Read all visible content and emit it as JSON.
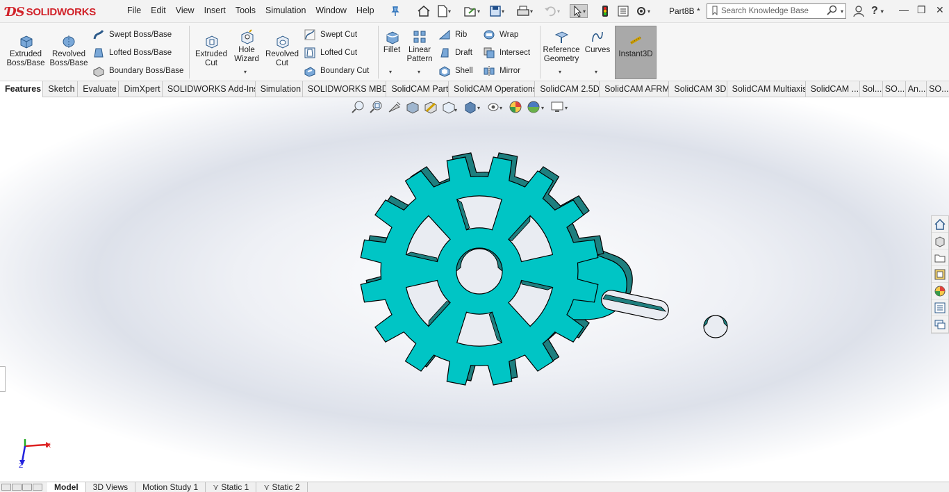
{
  "app": {
    "logo_ds": "ƊS",
    "logo_text": "SOLIDWORKS",
    "document_name": "Part8B *"
  },
  "menu": [
    "File",
    "Edit",
    "View",
    "Insert",
    "Tools",
    "Simulation",
    "Window",
    "Help"
  ],
  "search": {
    "placeholder": "Search Knowledge Base"
  },
  "ribbon": {
    "extruded_boss": "Extruded Boss/Base",
    "revolved_boss": "Revolved Boss/Base",
    "swept_boss": "Swept Boss/Base",
    "lofted_boss": "Lofted Boss/Base",
    "boundary_boss": "Boundary Boss/Base",
    "extruded_cut": "Extruded Cut",
    "hole_wizard": "Hole Wizard",
    "revolved_cut": "Revolved Cut",
    "swept_cut": "Swept Cut",
    "lofted_cut": "Lofted Cut",
    "boundary_cut": "Boundary Cut",
    "fillet": "Fillet",
    "linear_pattern": "Linear Pattern",
    "rib": "Rib",
    "draft": "Draft",
    "shell": "Shell",
    "wrap": "Wrap",
    "intersect": "Intersect",
    "mirror": "Mirror",
    "reference_geometry": "Reference Geometry",
    "curves": "Curves",
    "instant3d": "Instant3D"
  },
  "tabs": [
    "Features",
    "Sketch",
    "Evaluate",
    "DimXpert",
    "SOLIDWORKS Add-Ins",
    "Simulation",
    "SOLIDWORKS MBD",
    "SolidCAM Part",
    "SolidCAM Operations",
    "SolidCAM 2.5D",
    "SolidCAM AFRM",
    "SolidCAM 3D",
    "SolidCAM Multiaxis",
    "SolidCAM ...",
    "Sol...",
    "SO...",
    "An...",
    "SO..."
  ],
  "active_tab": "Features",
  "triad": {
    "x_label": "X",
    "z_label": "Z"
  },
  "bottom_tabs": [
    "Model",
    "3D Views",
    "Motion Study 1",
    "Static 1",
    "Static 2"
  ],
  "active_bottom_tab": "Model",
  "colors": {
    "part_face": "#00c5c5",
    "part_side": "#1e7f7f",
    "brand_red": "#d1232a",
    "instant3d_active": "#a9a9a9"
  }
}
